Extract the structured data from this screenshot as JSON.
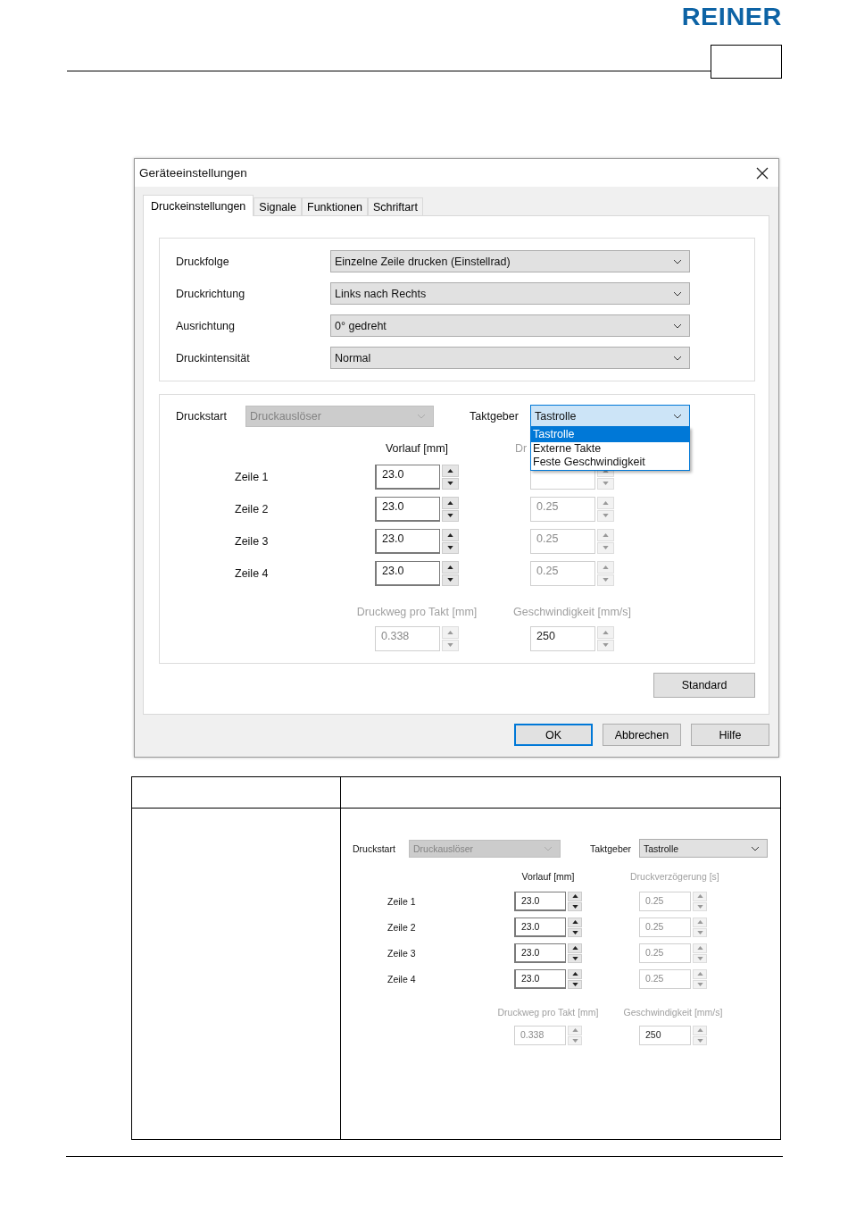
{
  "header": {
    "logo": "REINER"
  },
  "dialog": {
    "title": "Geräteeinstellungen",
    "tabs": [
      {
        "label": "Druckeinstellungen",
        "selected": true
      },
      {
        "label": "Signale",
        "selected": false
      },
      {
        "label": "Funktionen",
        "selected": false
      },
      {
        "label": "Schriftart",
        "selected": false
      }
    ],
    "settings": [
      {
        "label": "Druckfolge",
        "value": "Einzelne Zeile drucken (Einstellrad)"
      },
      {
        "label": "Druckrichtung",
        "value": "Links nach Rechts"
      },
      {
        "label": "Ausrichtung",
        "value": "0° gedreht"
      },
      {
        "label": "Druckintensität",
        "value": "Normal"
      }
    ],
    "panel": {
      "druckstart": {
        "label": "Druckstart",
        "value": "Druckauslöser",
        "disabled": true
      },
      "taktgeber": {
        "label": "Taktgeber",
        "value": "Tastrolle",
        "options": [
          {
            "label": "Tastrolle",
            "selected": true
          },
          {
            "label": "Externe Takte",
            "selected": false
          },
          {
            "label": "Feste Geschwindigkeit",
            "selected": false
          }
        ]
      },
      "headings": [
        {
          "text": "Vorlauf [mm]",
          "disabled": false
        },
        {
          "text": "Dr",
          "disabled": true
        }
      ],
      "rows": [
        {
          "label": "Zeile 1",
          "lead": {
            "value": "23.0",
            "kind": "edit"
          },
          "delay": {
            "kind": "disabled"
          }
        },
        {
          "label": "Zeile 2",
          "lead": {
            "value": "23.0",
            "kind": "edit"
          },
          "delay": {
            "value": "0.25",
            "kind": "disabled"
          }
        },
        {
          "label": "Zeile 3",
          "lead": {
            "value": "23.0",
            "kind": "edit"
          },
          "delay": {
            "value": "0.25",
            "kind": "disabled"
          }
        },
        {
          "label": "Zeile 4",
          "lead": {
            "value": "23.0",
            "kind": "edit"
          },
          "delay": {
            "value": "0.25",
            "kind": "disabled"
          }
        }
      ],
      "bottom_headings": [
        {
          "text": "Druckweg pro Takt [mm]",
          "disabled": true
        },
        {
          "text": "Geschwindigkeit [mm/s]",
          "disabled": true
        }
      ],
      "bottom_fields": [
        {
          "value": "0.338",
          "kind": "disabled"
        },
        {
          "value": "250",
          "kind": "readonly"
        }
      ]
    },
    "standard_button": "Standard",
    "buttons": [
      {
        "label": "OK",
        "default": true
      },
      {
        "label": "Abbrechen",
        "default": false
      },
      {
        "label": "Hilfe",
        "default": false
      }
    ]
  },
  "table": {
    "example": {
      "druckstart": {
        "label": "Druckstart",
        "value": "Druckauslöser",
        "disabled": true
      },
      "taktgeber": {
        "label": "Taktgeber",
        "value": "Tastrolle"
      },
      "headings": [
        {
          "text": "Vorlauf [mm]",
          "disabled": false
        },
        {
          "text": "Druckverzögerung [s]",
          "disabled": true
        }
      ],
      "rows": [
        {
          "label": "Zeile 1",
          "lead": {
            "value": "23.0",
            "kind": "edit"
          },
          "delay": {
            "value": "0.25",
            "kind": "disabled"
          }
        },
        {
          "label": "Zeile 2",
          "lead": {
            "value": "23.0",
            "kind": "edit"
          },
          "delay": {
            "value": "0.25",
            "kind": "disabled"
          }
        },
        {
          "label": "Zeile 3",
          "lead": {
            "value": "23.0",
            "kind": "edit"
          },
          "delay": {
            "value": "0.25",
            "kind": "disabled"
          }
        },
        {
          "label": "Zeile 4",
          "lead": {
            "value": "23.0",
            "kind": "edit"
          },
          "delay": {
            "value": "0.25",
            "kind": "disabled"
          }
        }
      ],
      "bottom_headings": [
        {
          "text": "Druckweg pro Takt [mm]",
          "disabled": true
        },
        {
          "text": "Geschwindigkeit [mm/s]",
          "disabled": true
        }
      ],
      "bottom_fields": [
        {
          "value": "0.338",
          "kind": "disabled"
        },
        {
          "value": "250",
          "kind": "readonly"
        }
      ]
    }
  }
}
